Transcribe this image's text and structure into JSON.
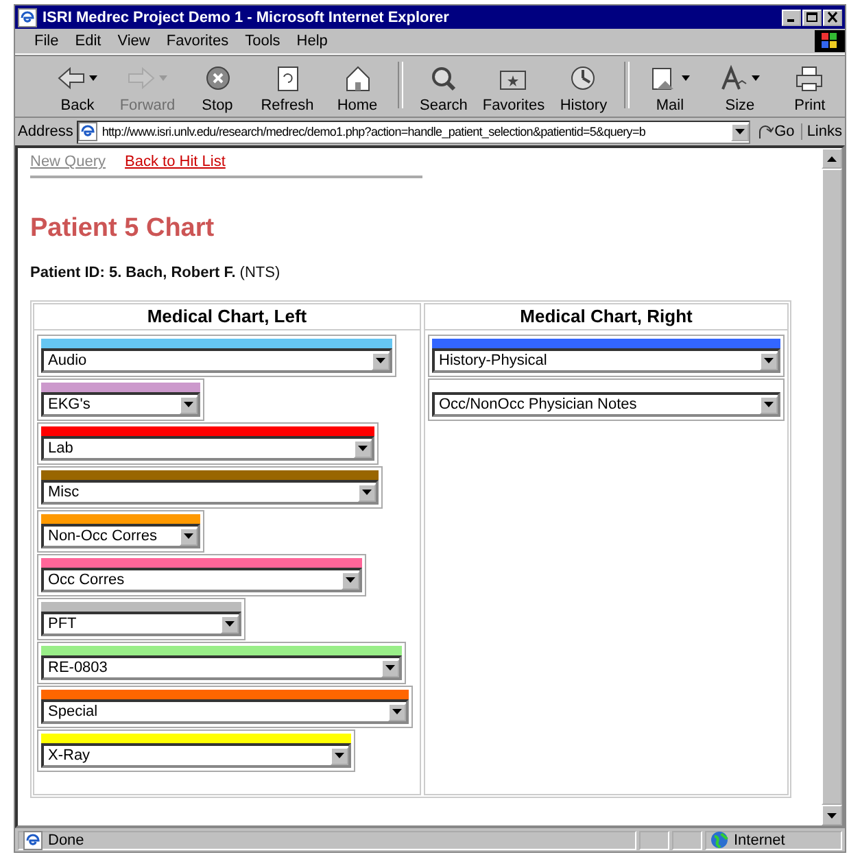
{
  "window": {
    "title": "ISRI Medrec Project Demo 1 - Microsoft Internet Explorer"
  },
  "menu": [
    "File",
    "Edit",
    "View",
    "Favorites",
    "Tools",
    "Help"
  ],
  "toolbar": [
    {
      "label": "Back",
      "kind": "back",
      "disabled": false,
      "dropdown": true
    },
    {
      "label": "Forward",
      "kind": "forward",
      "disabled": true,
      "dropdown": true
    },
    {
      "label": "Stop",
      "kind": "stop",
      "disabled": false,
      "dropdown": false
    },
    {
      "label": "Refresh",
      "kind": "refresh",
      "disabled": false,
      "dropdown": false
    },
    {
      "label": "Home",
      "kind": "home",
      "disabled": false,
      "dropdown": false
    },
    {
      "label": "Search",
      "kind": "search",
      "disabled": false,
      "dropdown": false
    },
    {
      "label": "Favorites",
      "kind": "favorites",
      "disabled": false,
      "dropdown": false
    },
    {
      "label": "History",
      "kind": "history",
      "disabled": false,
      "dropdown": false
    },
    {
      "label": "Mail",
      "kind": "mail",
      "disabled": false,
      "dropdown": true
    },
    {
      "label": "Size",
      "kind": "size",
      "disabled": false,
      "dropdown": true
    },
    {
      "label": "Print",
      "kind": "print",
      "disabled": false,
      "dropdown": false
    }
  ],
  "address": {
    "label": "Address",
    "value": "http://www.isri.unlv.edu/research/medrec/demo1.php?action=handle_patient_selection&patientid=5&query=b",
    "go": "Go",
    "links": "Links"
  },
  "page": {
    "links": [
      {
        "text": "New Query",
        "visited": true
      },
      {
        "text": "Back to Hit List",
        "visited": false
      }
    ],
    "heading": "Patient 5 Chart",
    "patient": "**Patient ID: 5. Bach, Robert F.** (NTS)",
    "columns": [
      {
        "heading": "Medical Chart, Left",
        "sections": [
          {
            "value": "Audio",
            "color": "#66c6f2"
          },
          {
            "value": "EKG's",
            "color": "#cc99cc"
          },
          {
            "value": "Lab",
            "color": "#ff0000"
          },
          {
            "value": "Misc",
            "color": "#996600"
          },
          {
            "value": "Non-Occ Corres",
            "color": "#ff9900"
          },
          {
            "value": "Occ Corres",
            "color": "#ff6699"
          },
          {
            "value": "PFT",
            "color": "#bbbbbb"
          },
          {
            "value": "RE-0803",
            "color": "#99ee88"
          },
          {
            "value": "Special",
            "color": "#ff6600"
          },
          {
            "value": "X-Ray",
            "color": "#ffff00"
          }
        ]
      },
      {
        "heading": "Medical Chart, Right",
        "sections": [
          {
            "value": "History-Physical",
            "color": "#3366ff"
          },
          {
            "value": "Occ/NonOcc Physician Notes"
          }
        ]
      }
    ]
  },
  "status_bar": {
    "text": "Done",
    "zone": "Internet"
  }
}
